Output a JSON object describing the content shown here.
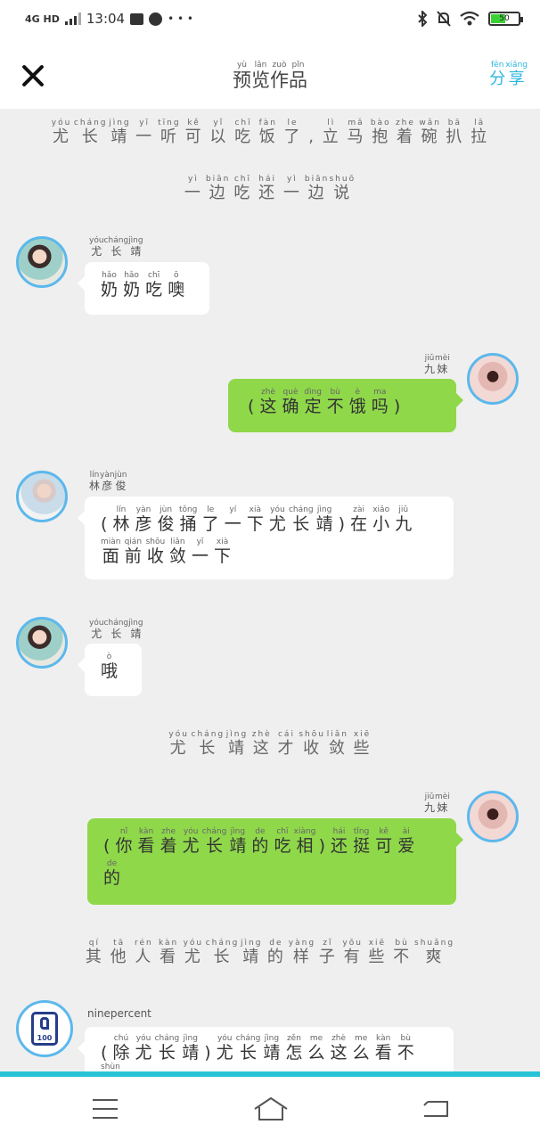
{
  "status_bar": {
    "network": "4G HD",
    "time": "13:04",
    "extra": "• • •",
    "battery": "50"
  },
  "header": {
    "title": {
      "chars": [
        "预",
        "览",
        "作",
        "品"
      ],
      "pinyin": [
        "yù",
        "lǎn",
        "zuò",
        "pǐn"
      ]
    },
    "share": {
      "chars": [
        "分",
        "享"
      ],
      "pinyin": [
        "fēn",
        "xiǎng"
      ]
    }
  },
  "narration": [
    {
      "chars": [
        "尤",
        "长",
        "靖",
        "一",
        "听",
        "可",
        "以",
        "吃",
        "饭",
        "了",
        ",",
        "立",
        "马",
        "抱",
        "着",
        "碗",
        "扒",
        "拉"
      ],
      "pinyin": [
        "yóu",
        "cháng",
        "jìng",
        "yī",
        "tīng",
        "kě",
        "yǐ",
        "chī",
        "fàn",
        "le",
        "",
        "lì",
        "mǎ",
        "bào",
        "zhe",
        "wǎn",
        "bā",
        "lā"
      ]
    },
    {
      "chars": [
        "一",
        "边",
        "吃",
        "还",
        "一",
        "边",
        "说"
      ],
      "pinyin": [
        "yì",
        "biān",
        "chī",
        "hái",
        "yì",
        "biān",
        "shuō"
      ]
    },
    {
      "chars": [
        "尤",
        "长",
        "靖",
        "这",
        "才",
        "收",
        "敛",
        "些"
      ],
      "pinyin": [
        "yóu",
        "cháng",
        "jìng",
        "zhè",
        "cái",
        "shōu",
        "liǎn",
        "xiē"
      ]
    },
    {
      "chars": [
        "其",
        "他",
        "人",
        "看",
        "尤",
        "长",
        "靖",
        "的",
        "样",
        "子",
        "有",
        "些",
        "不",
        "爽"
      ],
      "pinyin": [
        "qí",
        "tā",
        "rén",
        "kàn",
        "yóu",
        "cháng",
        "jìng",
        "de",
        "yàng",
        "zǐ",
        "yǒu",
        "xiē",
        "bù",
        "shuǎng"
      ]
    }
  ],
  "messages": [
    {
      "name": {
        "chars": [
          "尤",
          "长",
          "靖"
        ],
        "pinyin": [
          "yóu",
          "cháng",
          "jìng"
        ]
      },
      "lines": [
        {
          "chars": [
            "奶",
            "奶",
            "吃",
            "噢"
          ],
          "pinyin": [
            "hǎo",
            "hǎo",
            "chī",
            "ō"
          ]
        }
      ]
    },
    {
      "name": {
        "chars": [
          "九",
          "妹"
        ],
        "pinyin": [
          "jiǔ",
          "mèi"
        ]
      },
      "lines": [
        {
          "chars": [
            "(",
            "这",
            "确",
            "定",
            "不",
            "饿",
            "吗",
            ")"
          ],
          "pinyin": [
            "",
            "zhè",
            "què",
            "dìng",
            "bù",
            "è",
            "ma",
            ""
          ]
        }
      ]
    },
    {
      "name": {
        "chars": [
          "林",
          "彦",
          "俊"
        ],
        "pinyin": [
          "lín",
          "yàn",
          "jùn"
        ]
      },
      "lines": [
        {
          "chars": [
            "(",
            "林",
            "彦",
            "俊",
            "捅",
            "了",
            "一",
            "下",
            "尤",
            "长",
            "靖",
            ")",
            "在",
            "小",
            "九"
          ],
          "pinyin": [
            "",
            "lín",
            "yàn",
            "jùn",
            "tǒng",
            "le",
            "yí",
            "xià",
            "yóu",
            "cháng",
            "jìng",
            "",
            "zài",
            "xiǎo",
            "jiǔ"
          ]
        },
        {
          "chars": [
            "面",
            "前",
            "收",
            "敛",
            "一",
            "下"
          ],
          "pinyin": [
            "miàn",
            "qián",
            "shōu",
            "liǎn",
            "yī",
            "xià"
          ]
        }
      ]
    },
    {
      "name": {
        "chars": [
          "尤",
          "长",
          "靖"
        ],
        "pinyin": [
          "yóu",
          "cháng",
          "jìng"
        ]
      },
      "lines": [
        {
          "chars": [
            "哦"
          ],
          "pinyin": [
            "ò"
          ]
        }
      ]
    },
    {
      "name": {
        "chars": [
          "九",
          "妹"
        ],
        "pinyin": [
          "jiǔ",
          "mèi"
        ]
      },
      "lines": [
        {
          "chars": [
            "(",
            "你",
            "看",
            "着",
            "尤",
            "长",
            "靖",
            "的",
            "吃",
            "相",
            ")",
            "还",
            "挺",
            "可",
            "爱"
          ],
          "pinyin": [
            "",
            "nǐ",
            "kàn",
            "zhe",
            "yóu",
            "cháng",
            "jìng",
            "de",
            "chī",
            "xiàng",
            "",
            "hái",
            "tǐng",
            "kě",
            "ài"
          ]
        },
        {
          "chars": [
            "的"
          ],
          "pinyin": [
            "de"
          ]
        }
      ]
    },
    {
      "name_text": "ninepercent",
      "avatar_text": "100",
      "lines": [
        {
          "chars": [
            "(",
            "除",
            "尤",
            "长",
            "靖",
            ")",
            "尤",
            "长",
            "靖",
            "怎",
            "么",
            "这",
            "么",
            "看",
            "不",
            "顺"
          ],
          "pinyin": [
            "",
            "chú",
            "yóu",
            "cháng",
            "jìng",
            "",
            "yóu",
            "cháng",
            "jìng",
            "zěn",
            "me",
            "zhè",
            "me",
            "kàn",
            "bù",
            "shùn"
          ]
        }
      ]
    }
  ],
  "colors": {
    "accent": "#27c3d6",
    "avatar_ring": "#5cb8ec",
    "outgoing_bubble": "#8fd84a",
    "share_text": "#2bb5e0"
  },
  "icons": [
    "close-icon",
    "bluetooth-icon",
    "mute-icon",
    "wifi-icon",
    "battery-icon",
    "menu-icon",
    "home-icon",
    "back-icon"
  ]
}
